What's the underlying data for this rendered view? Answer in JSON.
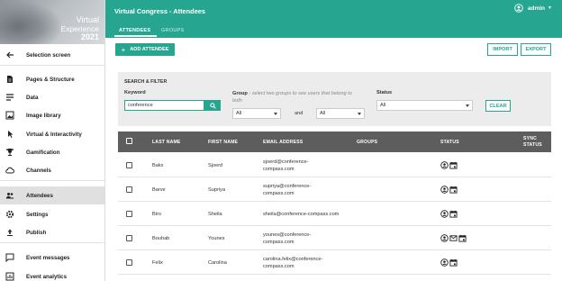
{
  "brand": {
    "line1": "Virtual",
    "line2": "Experience",
    "line3": "2021"
  },
  "sidebar": {
    "items": [
      {
        "label": "Selection screen",
        "icon": "arrow-left-icon"
      },
      {
        "label": "Pages & Structure",
        "icon": "page-icon"
      },
      {
        "label": "Data",
        "icon": "list-icon"
      },
      {
        "label": "Image library",
        "icon": "image-icon"
      },
      {
        "label": "Virtual & Interactivity",
        "icon": "cursor-icon"
      },
      {
        "label": "Gamification",
        "icon": "trophy-icon"
      },
      {
        "label": "Channels",
        "icon": "cloud-icon"
      },
      {
        "label": "Attendees",
        "icon": "people-icon"
      },
      {
        "label": "Settings",
        "icon": "gear-icon"
      },
      {
        "label": "Publish",
        "icon": "upload-icon"
      },
      {
        "label": "Event messages",
        "icon": "message-icon"
      },
      {
        "label": "Event analytics",
        "icon": "analytics-icon"
      }
    ],
    "active": "Attendees"
  },
  "header": {
    "title": "Virtual Congress - Attendees",
    "tabs": [
      "ATTENDEES",
      "GROUPS"
    ],
    "user": "admin"
  },
  "actions": {
    "add": "ADD ATTENDEE",
    "import": "IMPORT",
    "export": "EXPORT"
  },
  "filter": {
    "title": "SEARCH & FILTER",
    "keyword_label": "Keyword",
    "keyword_value": "conference",
    "group_label": "Group",
    "group_hint": "- select two groups to see users that belong to both",
    "group1": "All",
    "and_label": "and",
    "group2": "All",
    "status_label": "Status",
    "status_value": "All",
    "clear": "CLEAR"
  },
  "table": {
    "columns": [
      "LAST NAME",
      "FIRST NAME",
      "EMAIL ADDRESS",
      "GROUPS",
      "STATUS",
      "SYNC",
      "STATUS"
    ],
    "rows": [
      {
        "last": "Bakx",
        "first": "Sjoerd",
        "email1": "sjoerd@conference-",
        "email2": "compass.com",
        "icons": [
          "user-check-icon",
          "calendar-icon"
        ]
      },
      {
        "last": "Barve",
        "first": "Supriya",
        "email1": "supriya@conference-",
        "email2": "compass.com",
        "icons": [
          "user-check-icon",
          "calendar-icon"
        ]
      },
      {
        "last": "Biro",
        "first": "Sheila",
        "email1": "sheila@conference-compass.com",
        "email2": "",
        "icons": [
          "user-check-icon",
          "calendar-icon"
        ]
      },
      {
        "last": "Bouhab",
        "first": "Younes",
        "email1": "younes@conference-",
        "email2": "compass.com",
        "icons": [
          "user-check-icon",
          "mail-icon",
          "calendar-icon"
        ]
      },
      {
        "last": "Felix",
        "first": "Carolina",
        "email1": "carolina.felix@conference-",
        "email2": "compass.com",
        "icons": [
          "user-check-icon",
          "calendar-icon"
        ]
      }
    ]
  },
  "colors": {
    "accent": "#26a690",
    "header_table": "#5d5d5d",
    "filter_bg": "#ececec"
  }
}
